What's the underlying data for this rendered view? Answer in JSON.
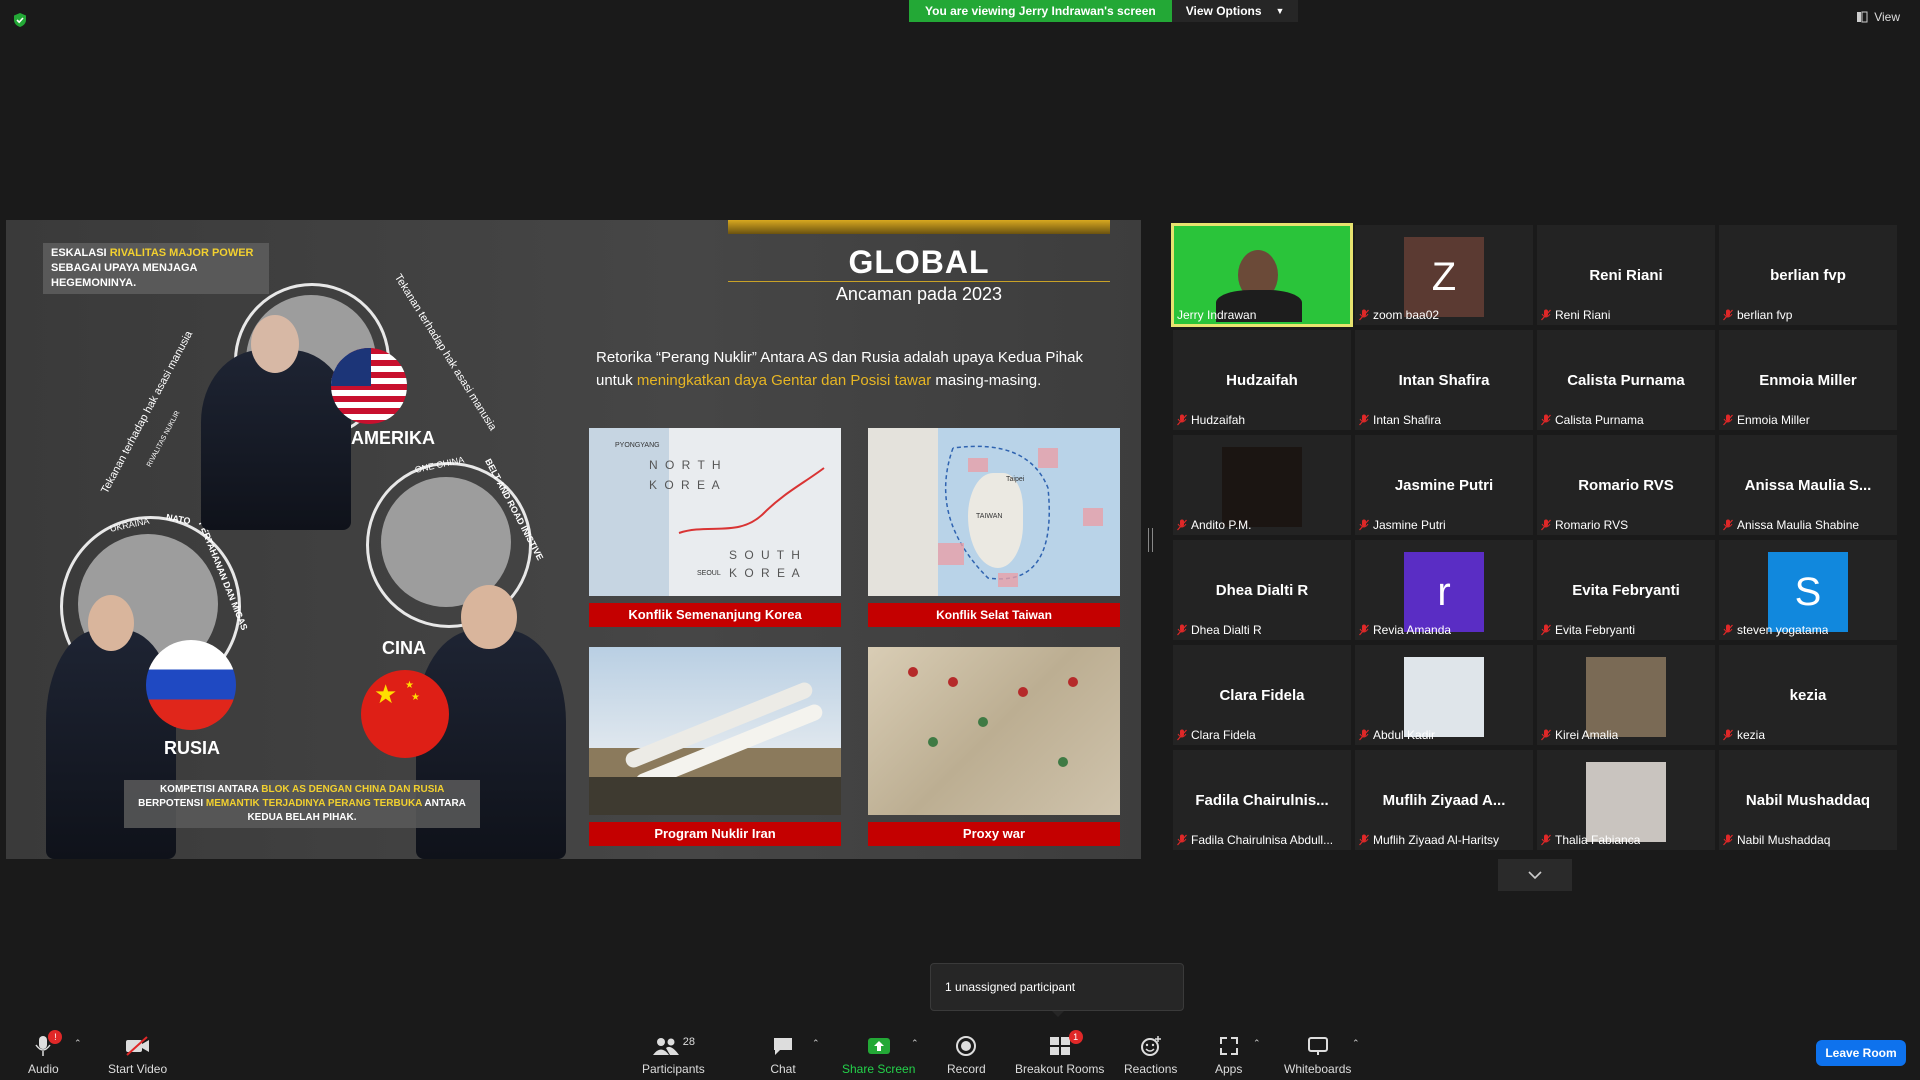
{
  "banner": {
    "viewing": "You are viewing Jerry Indrawan's screen",
    "view_options": "View Options"
  },
  "view_button": "View",
  "slide": {
    "note_top_pre": "ESKALASI ",
    "note_top_hl": "RIVALITAS MAJOR POWER",
    "note_top_post": " SEBAGAI UPAYA MENJAGA HEGEMONINYA.",
    "title": "GLOBAL",
    "subtitle": "Ancaman pada 2023",
    "body_pre": "Retorika “Perang Nuklir” Antara AS dan Rusia adalah upaya Kedua Pihak untuk ",
    "body_hl": "meningkatkan daya Gentar dan Posisi tawar",
    "body_post": " masing-masing.",
    "country_us": "AMERIKA",
    "country_ru": "RUSIA",
    "country_cn": "CINA",
    "arc_left": "Tekanan terhadap hak asasi manusia",
    "arc_left_small": "RIVALITAS NUKLIR",
    "arc_right": "Tekanan terhadap hak asasi manusia",
    "arc_onechina": "ONE CHINA",
    "arc_belt": "BELT AND ROAD INISTIVE",
    "arc_ukraina": "UKRAINA",
    "arc_nato": "NATO",
    "arc_pertahanan": "PERTAHANAN DAN MIGAS",
    "note_bottom_pre": "KOMPETISI ANTARA ",
    "note_bottom_hl1": "BLOK AS DENGAN CHINA DAN RUSIA",
    "note_bottom_mid": " BERPOTENSI ",
    "note_bottom_hl2": "MEMANTIK TERJADINYA PERANG TERBUKA",
    "note_bottom_post": " ANTARA KEDUA BELAH PIHAK.",
    "cards": [
      {
        "label": "Konflik Semenanjung Korea",
        "map_north": "N O R T H",
        "map_korea1": "K O R E A",
        "map_south": "S O U T H",
        "map_korea2": "K O R E A",
        "map_pyong": "PYONGYANG",
        "map_seoul": "SEOUL"
      },
      {
        "label": "Konflik Selat Taiwan",
        "map_taiwan": "TAIWAN",
        "map_taipei": "Taipei"
      },
      {
        "label": "Program Nuklir Iran"
      },
      {
        "label": "Proxy war"
      }
    ]
  },
  "participants": [
    {
      "name": "Jerry Indrawan",
      "label": "Jerry Indrawan",
      "type": "video",
      "active": true
    },
    {
      "name": "",
      "label": "zoom baa02",
      "type": "letter",
      "letter": "Z",
      "color": "#5b3a32"
    },
    {
      "name": "Reni Riani",
      "label": "Reni Riani",
      "type": "name"
    },
    {
      "name": "berlian fvp",
      "label": "berlian fvp",
      "type": "name"
    },
    {
      "name": "Hudzaifah",
      "label": "Hudzaifah",
      "type": "name"
    },
    {
      "name": "Intan Shafira",
      "label": "Intan Shafira",
      "type": "name"
    },
    {
      "name": "Calista Purnama",
      "label": "Calista Purnama",
      "type": "name"
    },
    {
      "name": "Enmoia Miller",
      "label": "Enmoia Miller",
      "type": "name"
    },
    {
      "name": "",
      "label": "Andito P.M.",
      "type": "photo",
      "color": "#1b1512"
    },
    {
      "name": "Jasmine Putri",
      "label": "Jasmine Putri",
      "type": "name"
    },
    {
      "name": "Romario RVS",
      "label": "Romario RVS",
      "type": "name"
    },
    {
      "name": "Anissa Maulia S...",
      "label": "Anissa Maulia Shabine",
      "type": "name"
    },
    {
      "name": "Dhea Dialti R",
      "label": "Dhea Dialti R",
      "type": "name"
    },
    {
      "name": "",
      "label": "Revia Amanda",
      "type": "letter",
      "letter": "r",
      "color": "#5a2dc4"
    },
    {
      "name": "Evita Febryanti",
      "label": "Evita Febryanti",
      "type": "name"
    },
    {
      "name": "",
      "label": "steven yogatama",
      "type": "letter",
      "letter": "S",
      "color": "#1188dd"
    },
    {
      "name": "Clara Fidela",
      "label": "Clara Fidela",
      "type": "name"
    },
    {
      "name": "",
      "label": "Abdul Kadir",
      "type": "photo",
      "color": "#dfe5ea"
    },
    {
      "name": "",
      "label": "Kirei Amalia",
      "type": "photo",
      "color": "#7a6a55"
    },
    {
      "name": "kezia",
      "label": "kezia",
      "type": "name"
    },
    {
      "name": "Fadila  Chairulnis...",
      "label": "Fadila Chairulnisa Abdull...",
      "type": "name"
    },
    {
      "name": "Muflih Ziyaad A...",
      "label": "Muflih Ziyaad Al-Haritsy",
      "type": "name"
    },
    {
      "name": "",
      "label": "Thalia Fabianca",
      "type": "photo",
      "color": "#c9c4bf"
    },
    {
      "name": "Nabil Mushaddaq",
      "label": "Nabil Mushaddaq",
      "type": "name"
    }
  ],
  "tooltip": "1 unassigned participant",
  "toolbar": {
    "audio": "Audio",
    "audio_badge": "!",
    "start_video": "Start Video",
    "participants": "Participants",
    "participants_count": "28",
    "chat": "Chat",
    "share_screen": "Share Screen",
    "record": "Record",
    "breakout": "Breakout Rooms",
    "breakout_badge": "1",
    "reactions": "Reactions",
    "apps": "Apps",
    "whiteboards": "Whiteboards",
    "leave": "Leave Room"
  },
  "colors": {
    "share_green": "#23a836",
    "active_border": "#e7e36f",
    "leave_blue": "#0e72ed",
    "slide_red": "#c40000",
    "highlight_yellow": "#f2d02f"
  }
}
